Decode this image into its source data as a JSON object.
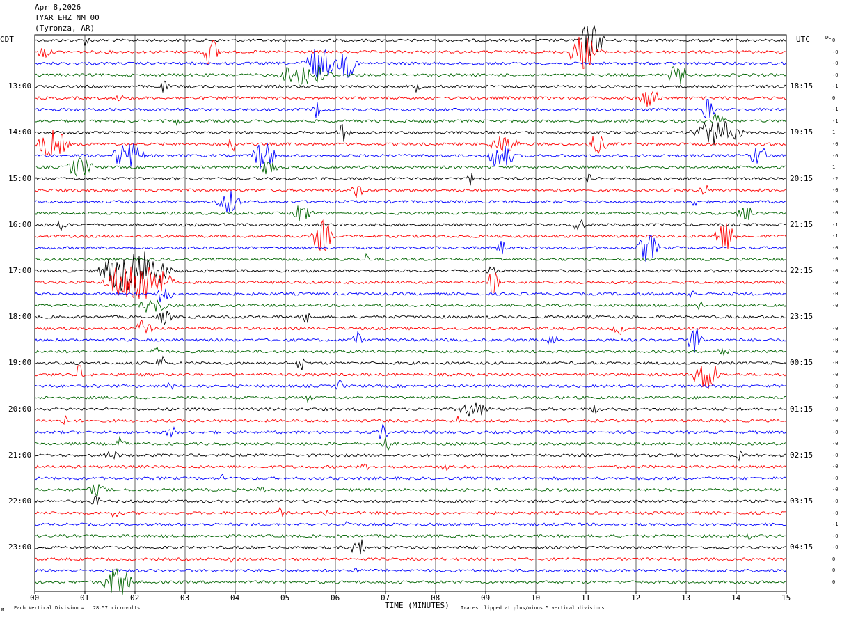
{
  "header": {
    "date": "Apr 8,2026",
    "station": "TYAR EHZ NM 00",
    "location": "(Tyronza, AR)"
  },
  "left_zone": "CDT",
  "right_zone": "UTC",
  "dc_label": "DC",
  "footer": {
    "vertical_division": "Each Vertical Division =   28.57 microvolts",
    "clipping": "Traces clipped at plus/minus 5 vertical divisions",
    "corner_mark": "ᴍ"
  },
  "chart_data": {
    "type": "line",
    "title": "",
    "xlabel": "TIME (MINUTES)",
    "ylabel": "",
    "xlim": [
      0,
      15
    ],
    "x_ticks": [
      "00",
      "01",
      "02",
      "03",
      "04",
      "05",
      "06",
      "07",
      "08",
      "09",
      "10",
      "11",
      "12",
      "13",
      "14",
      "15"
    ],
    "left_hour_labels": [
      "13:00",
      "14:00",
      "15:00",
      "16:00",
      "17:00",
      "18:00",
      "19:00",
      "20:00",
      "21:00",
      "22:00",
      "23:00"
    ],
    "right_hour_labels": [
      "18:15",
      "19:15",
      "20:15",
      "21:15",
      "22:15",
      "23:15",
      "00:15",
      "01:15",
      "02:15",
      "03:15",
      "04:15"
    ],
    "trace_count": 48,
    "trace_minutes": 15,
    "trace_colors": [
      "#000000",
      "#ff0000",
      "#0000ff",
      "#006400"
    ],
    "dc_offsets": [
      "0",
      "-0",
      "-0",
      "-0",
      "-1",
      "0",
      "-1",
      "-1",
      "1",
      "-0",
      "-6",
      "1",
      "-2",
      "-0",
      "-0",
      "-0",
      "-1",
      "-1",
      "-0",
      "-0",
      "-0",
      "-0",
      "-0",
      "-0",
      "1",
      "-0",
      "-0",
      "-0",
      "-0",
      "-0",
      "-0",
      "-0",
      "-0",
      "-0",
      "-0",
      "-0",
      "-0",
      "-0",
      "-0",
      "-0",
      "-0",
      "-0",
      "-1",
      "-0",
      "-0",
      "0",
      "0",
      "0"
    ],
    "clip_divisions": 5,
    "microvolts_per_division": 28.57
  }
}
